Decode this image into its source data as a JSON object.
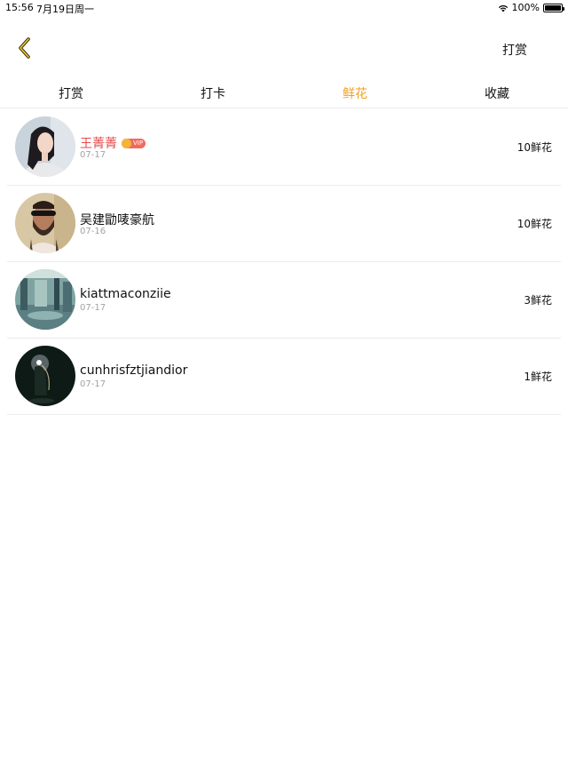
{
  "status_bar": {
    "time": "15:56",
    "date": "7月19日周一",
    "battery": "100%"
  },
  "nav": {
    "back_icon": "chevron-left-icon",
    "action_label": "打赏"
  },
  "tabs": [
    {
      "label": "打赏",
      "active": false
    },
    {
      "label": "打卡",
      "active": false
    },
    {
      "label": "鲜花",
      "active": true
    },
    {
      "label": "收藏",
      "active": false
    }
  ],
  "list": [
    {
      "name": "王菁菁",
      "vip": true,
      "vip_label": "VIP",
      "date": "07-17",
      "amount": "10鲜花"
    },
    {
      "name": "吴建勖唛豪航",
      "vip": false,
      "date": "07-16",
      "amount": "10鲜花"
    },
    {
      "name": "kiattmaconziie",
      "vip": false,
      "date": "07-17",
      "amount": "3鲜花"
    },
    {
      "name": "cunhrisfztjiandior",
      "vip": false,
      "date": "07-17",
      "amount": "1鲜花"
    }
  ],
  "colors": {
    "accent": "#f0a21d",
    "vip_name": "#e64b4b",
    "vip_badge": "#f26a5c",
    "divider": "#ececec",
    "date": "#a2a2a2"
  }
}
